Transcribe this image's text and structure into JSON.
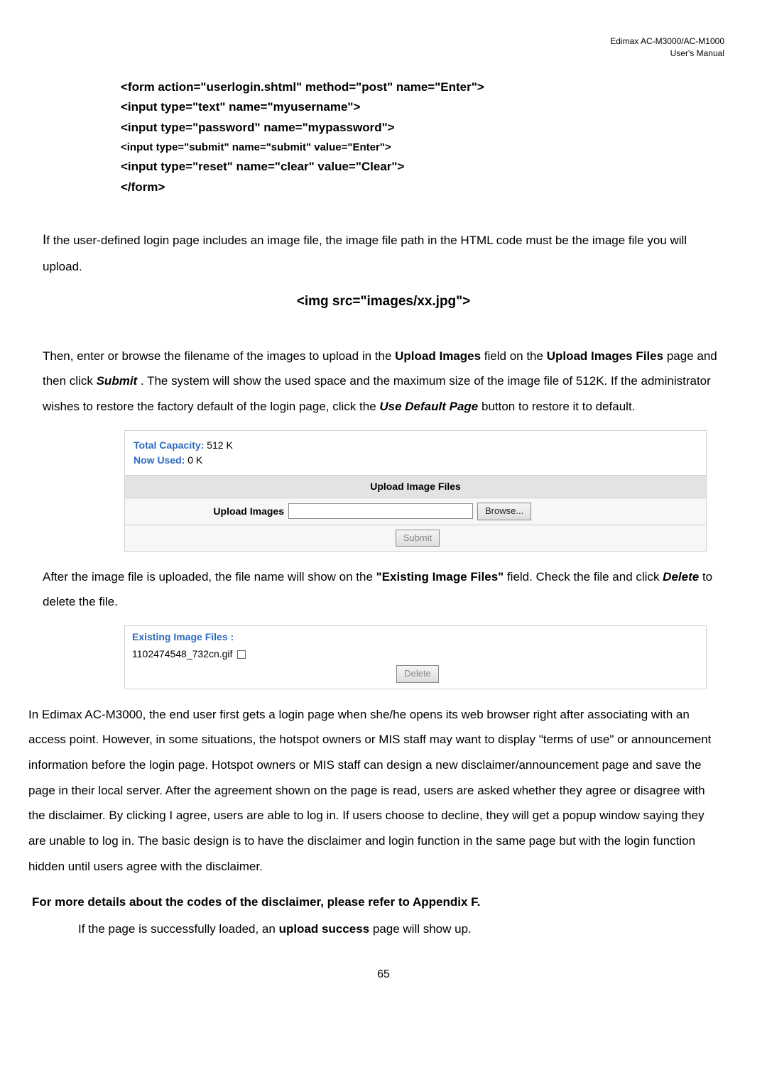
{
  "header": {
    "line1": "Edimax  AC-M3000/AC-M1000",
    "line2": "User's  Manual"
  },
  "code1": {
    "l1": "<form action=\"userlogin.shtml\" method=\"post\" name=\"Enter\">",
    "l2": "<input type=\"text\" name=\"myusername\">",
    "l3": "<input type=\"password\" name=\"mypassword\">",
    "l4": "<input type=\"submit\" name=\"submit\" value=\"Enter\">",
    "l5": "<input type=\"reset\" name=\"clear\" value=\"Clear\">",
    "l6": "</form>"
  },
  "para1": {
    "initial": "I",
    "rest": "f the user-defined login page includes an image file, the image file path in the HTML code must be the image file you will upload."
  },
  "center_code": "<img src=\"images/xx.jpg\">",
  "para2": {
    "t1": "Then, enter or browse the filename of the images to upload in the ",
    "b1": "Upload Images",
    "t2": " field on the ",
    "b2": "Upload Images Files",
    "t3": " page and then click ",
    "bi1": "Submit",
    "t4": ". The system will show the used space and the maximum size of the image file of 512K. If the administrator wishes to restore the factory default of the login page, click the ",
    "bi2": "Use Default Page",
    "t5": " button to restore it to default."
  },
  "upload": {
    "tc_label": "Total Capacity: ",
    "tc_val": "512 K",
    "nu_label": "Now Used: ",
    "nu_val": "0 K",
    "section_title": "Upload Image Files",
    "row_label": "Upload Images",
    "browse": "Browse...",
    "submit": "Submit"
  },
  "para3": {
    "t1": "After the image file is uploaded, the file name will show on the ",
    "b1": "\"Existing Image Files\"",
    "t2": " field. Check the file and click ",
    "bi1": "Delete",
    "t3": " to delete the file."
  },
  "exist": {
    "title": "Existing Image Files :",
    "file": "1102474548_732cn.gif",
    "delete": "Delete"
  },
  "para4": "In Edimax AC-M3000, the end user first gets a login page when she/he opens its web browser right after associating with an access point. However, in some situations, the hotspot owners or MIS staff may want to display \"terms of use\" or announcement information before the login page. Hotspot owners or MIS staff can design a new disclaimer/announcement page and save the page in their local server. After the agreement shown on the page is read, users are asked whether they agree or disagree with the disclaimer. By clicking I agree, users are able to log in. If users choose to decline, they will get a popup window saying they are unable to log in. The basic design is to have the disclaimer and login function in the same page but with the login function hidden until users agree with the disclaimer.",
  "para5": "For more details about the codes of the disclaimer, please refer to Appendix F.",
  "para6": {
    "t1": "If the page is successfully loaded, an ",
    "b1": "upload success",
    "t2": " page will show up."
  },
  "page_num": "65"
}
